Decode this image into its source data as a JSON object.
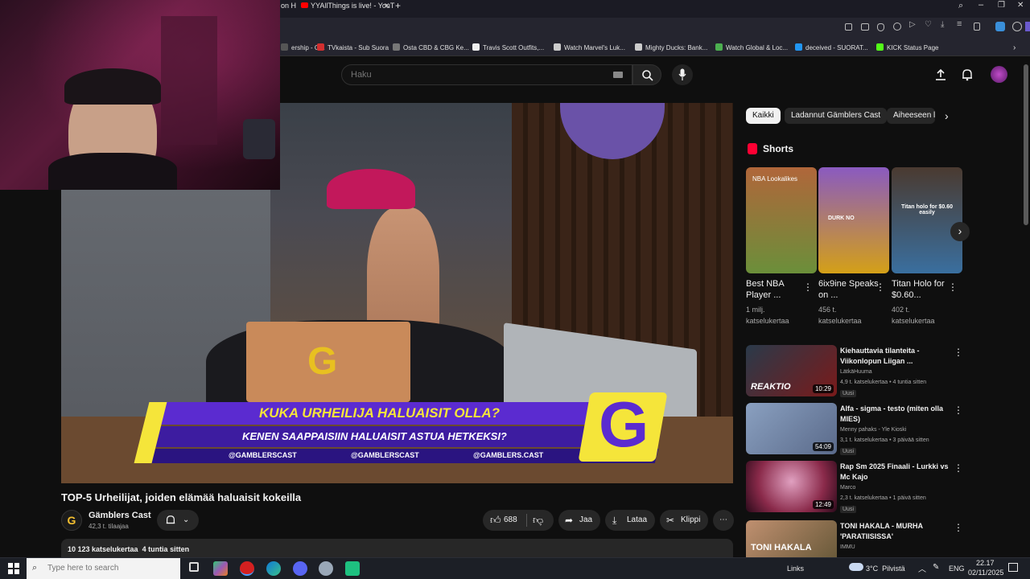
{
  "browser": {
    "tabs": [
      {
        "label": "on H"
      },
      {
        "label": "YYAllThings is live! - YouT"
      }
    ],
    "bookmarks": [
      {
        "label": "ership - G...",
        "color": "#555"
      },
      {
        "label": "TVkaista - Sub Suora",
        "color": "#d32f2f"
      },
      {
        "label": "Osta CBD & CBG Ke...",
        "color": "#777"
      },
      {
        "label": "Travis Scott Outfits,...",
        "color": "#eee"
      },
      {
        "label": "Watch Marvel's Luk...",
        "color": "#ccc"
      },
      {
        "label": "Mighty Ducks: Bank...",
        "color": "#ccc"
      },
      {
        "label": "Watch Global & Loc...",
        "color": "#4caf50"
      },
      {
        "label": "deceived - SUORAT...",
        "color": "#2196f3"
      },
      {
        "label": "KICK Status Page",
        "color": "#53fc18"
      }
    ]
  },
  "header": {
    "search_placeholder": "Haku"
  },
  "video": {
    "title": "TOP-5 Urheilijat, joiden elämää haluaisit kokeilla",
    "overlay_heading": "KUKA URHEILIJA HALUAISIT OLLA?",
    "overlay_subheading": "KENEN SAAPPAISIIN HALUAISIT ASTUA HETKEKSI?",
    "socials": [
      "@GAMBLERSCAST",
      "@GAMBLERSCAST",
      "@GAMBLERS.CAST"
    ],
    "logo_letter": "G",
    "views_line": "10 123 katselukertaa  4 tuntia sitten"
  },
  "channel": {
    "name": "Gämblers Cast",
    "subscribers": "42,3 t. tilaajaa",
    "avatar_letter": "G"
  },
  "actions": {
    "likes": "688",
    "share": "Jaa",
    "download": "Lataa",
    "clip": "Klippi"
  },
  "chips": [
    "Kaikki",
    "Ladannut Gämblers Cast",
    "Aiheeseen li"
  ],
  "shorts": {
    "heading": "Shorts",
    "items": [
      {
        "title": "Best NBA Player ...",
        "views": "1 milj. katselukertaa",
        "overlay": "NBA Lookalikes",
        "color": "#6b8f3a"
      },
      {
        "title": "6ix9ine Speaks on ...",
        "views": "456 t. katselukertaa",
        "overlay": "DURK NO",
        "color": "#d4a017"
      },
      {
        "title": "Titan Holo for $0.60...",
        "views": "402 t. katselukertaa",
        "overlay": "Titan holo for $0.60 easily",
        "color": "#3a6f9f"
      }
    ]
  },
  "related": [
    {
      "title": "Kiehauttavia tilanteita - Viikonlopun Liigan ...",
      "channel": "LätkäHuuma",
      "meta": "4,9 t. katselukertaa • 4 tuntia sitten",
      "badge": "Uusi",
      "duration": "10:29",
      "thumb_text": "REAKTIO",
      "color": "#7a1a1a"
    },
    {
      "title": "Alfa - sigma - testo (miten olla MIES)",
      "channel": "Menny pahaks - Yle Kioski",
      "meta": "3,1 t. katselukertaa • 3 päivää sitten",
      "badge": "Uusi",
      "duration": "54:09",
      "thumb_text": "",
      "color": "#5a6a8a"
    },
    {
      "title": "Rap Sm 2025 Finaali - Lurkki vs Mc Kajo",
      "channel": "Marco",
      "meta": "2,3 t. katselukertaa • 1 päivä sitten",
      "badge": "Uusi",
      "duration": "12:49",
      "thumb_text": "",
      "color": "#8a2a4a"
    },
    {
      "title": "TONI HAKALA - MURHA 'PARATIISISSA'",
      "channel": "IMMU",
      "meta": "",
      "badge": "",
      "duration": "",
      "thumb_text": "TONI HAKALA",
      "color": "#6a5a3a"
    }
  ],
  "taskbar": {
    "search_placeholder": "Type here to search",
    "links_label": "Links",
    "weather": "3°C  Pilvistä",
    "language": "ENG",
    "time": "22.17",
    "date": "02/11/2025"
  }
}
